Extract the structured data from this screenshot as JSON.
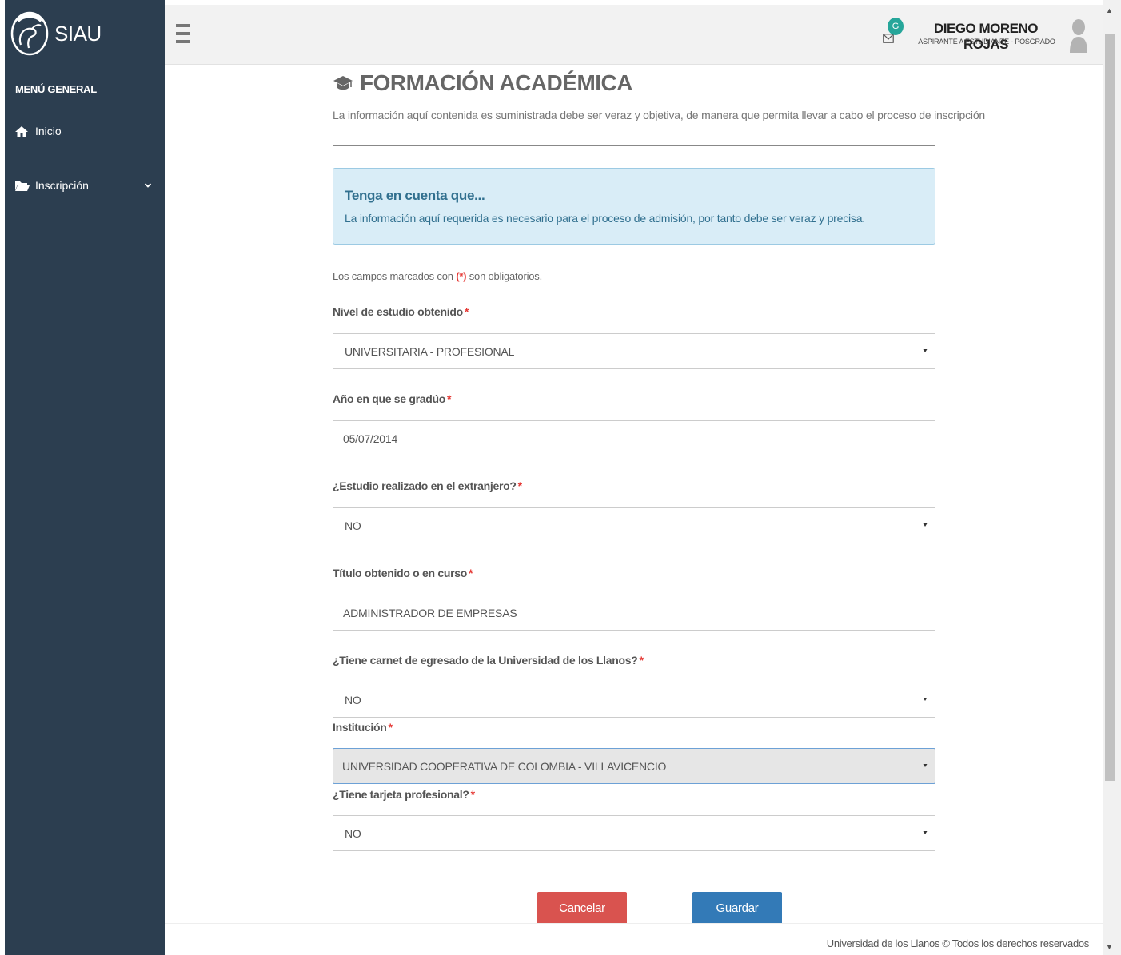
{
  "sidebar": {
    "app_name": "SIAU",
    "menu_title": "MENÚ GENERAL",
    "items": [
      {
        "label": "Inicio",
        "icon": "home-icon"
      },
      {
        "label": "Inscripción",
        "icon": "folder-open-icon"
      }
    ]
  },
  "header": {
    "notification_badge": "G",
    "user_name": "DIEGO MORENO ROJAS",
    "user_role": "ASPIRANTE A ESTUDIANTE - POSGRADO"
  },
  "page": {
    "title": "FORMACIÓN ACADÉMICA",
    "subtitle": "La información aquí contenida es suministrada debe ser veraz y objetiva, de manera que permita llevar a cabo el proceso de inscripción"
  },
  "alert": {
    "title": "Tenga en cuenta que...",
    "text": "La información aquí requerida es necesario para el proceso de admisión, por tanto debe ser veraz y precisa."
  },
  "form": {
    "required_note_prefix": "Los campos marcados con",
    "required_marker": "(*)",
    "required_note_suffix": "son obligatorios.",
    "asterisk": "*",
    "fields": [
      {
        "label": "Nivel de estudio obtenido",
        "type": "select",
        "value": "UNIVERSITARIA - PROFESIONAL"
      },
      {
        "label": "Año en que se gradúo",
        "type": "text",
        "value": "05/07/2014"
      },
      {
        "label": "¿Estudio realizado en el extranjero?",
        "type": "select",
        "value": "NO"
      },
      {
        "label": "Título obtenido o en curso",
        "type": "text",
        "value": "ADMINISTRADOR DE EMPRESAS"
      },
      {
        "label": "¿Tiene carnet de egresado de la Universidad de los Llanos?",
        "type": "select",
        "value": "NO"
      },
      {
        "label": "Institución",
        "type": "select",
        "value": "UNIVERSIDAD COOPERATIVA DE COLOMBIA - VILLAVICENCIO"
      },
      {
        "label": "¿Tiene tarjeta profesional?",
        "type": "select",
        "value": "NO"
      }
    ],
    "cancel_label": "Cancelar",
    "save_label": "Guardar"
  },
  "footer": {
    "text": "Universidad de los Llanos © Todos los derechos reservados"
  },
  "colors": {
    "sidebar_bg": "#2c3e50",
    "alert_bg": "#d9edf7",
    "alert_text": "#31708f",
    "cancel_button": "#d9534f",
    "save_button": "#337ab7",
    "required": "#e53935",
    "notification_badge": "#26a69a"
  }
}
